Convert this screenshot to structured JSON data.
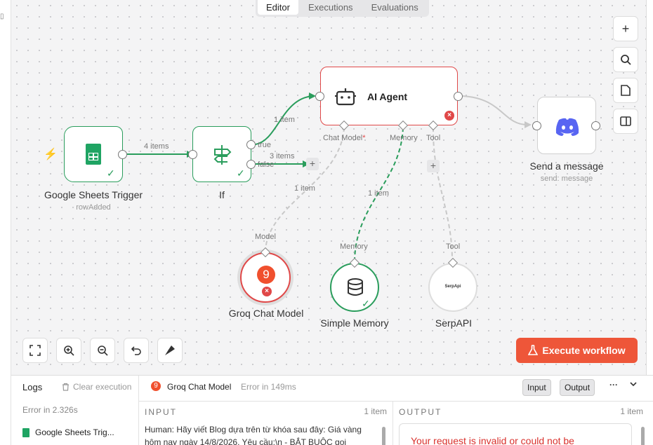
{
  "tabs": [
    {
      "label": "Editor"
    },
    {
      "label": "Executions"
    },
    {
      "label": "Evaluations"
    }
  ],
  "nodes": {
    "trigger": {
      "title": "Google Sheets Trigger",
      "subtitle": "rowAdded"
    },
    "if": {
      "title": "If",
      "true_label": "true",
      "false_label": "false"
    },
    "agent": {
      "title": "AI Agent",
      "ports": {
        "chat_model": "Chat Model",
        "memory": "Memory",
        "tool": "Tool"
      }
    },
    "send": {
      "title": "Send a message",
      "subtitle": "send: message"
    },
    "groq": {
      "title": "Groq Chat Model",
      "port": "Model"
    },
    "memory": {
      "title": "Simple Memory",
      "port": "Memory"
    },
    "serp": {
      "title": "SerpAPI",
      "port": "Tool",
      "logo_text": "SerpApi"
    }
  },
  "edge_labels": {
    "trigger_if": "4 items",
    "if_true": "1 item",
    "if_false": "3 items",
    "groq": "1 item",
    "memory": "1 item"
  },
  "execute_button": "Execute workflow",
  "icons": {
    "plus": "plus-icon",
    "zoom": "magnifier-icon",
    "note": "sticky-note-icon",
    "panel": "panel-icon",
    "fit": "fit-view-icon",
    "zoom_in": "zoom-in-icon",
    "zoom_out": "zoom-out-icon",
    "undo": "undo-icon",
    "clean": "clean-up-icon"
  },
  "logs": {
    "title": "Logs",
    "clear": "Clear execution",
    "error_time": "Error in 2.326s",
    "item": "Google Sheets Trig..."
  },
  "details": {
    "node_name": "Groq Chat Model",
    "status": "Error in 149ms",
    "input_btn": "Input",
    "output_btn": "Output",
    "more": "···",
    "input_head": "INPUT",
    "input_count": "1 item",
    "output_head": "OUTPUT",
    "output_count": "1 item",
    "input_text": "Human: Hãy viết Blog dựa trên từ khóa sau đây: Giá vàng hôm nay ngày 14/8/2026. Yêu cầu:\\n - BẮT BUỘC gọi",
    "output_error": "Your request is invalid or could not be"
  },
  "colors": {
    "green": "#2a9d5c",
    "red": "#e04848",
    "accent": "#ee5639"
  }
}
